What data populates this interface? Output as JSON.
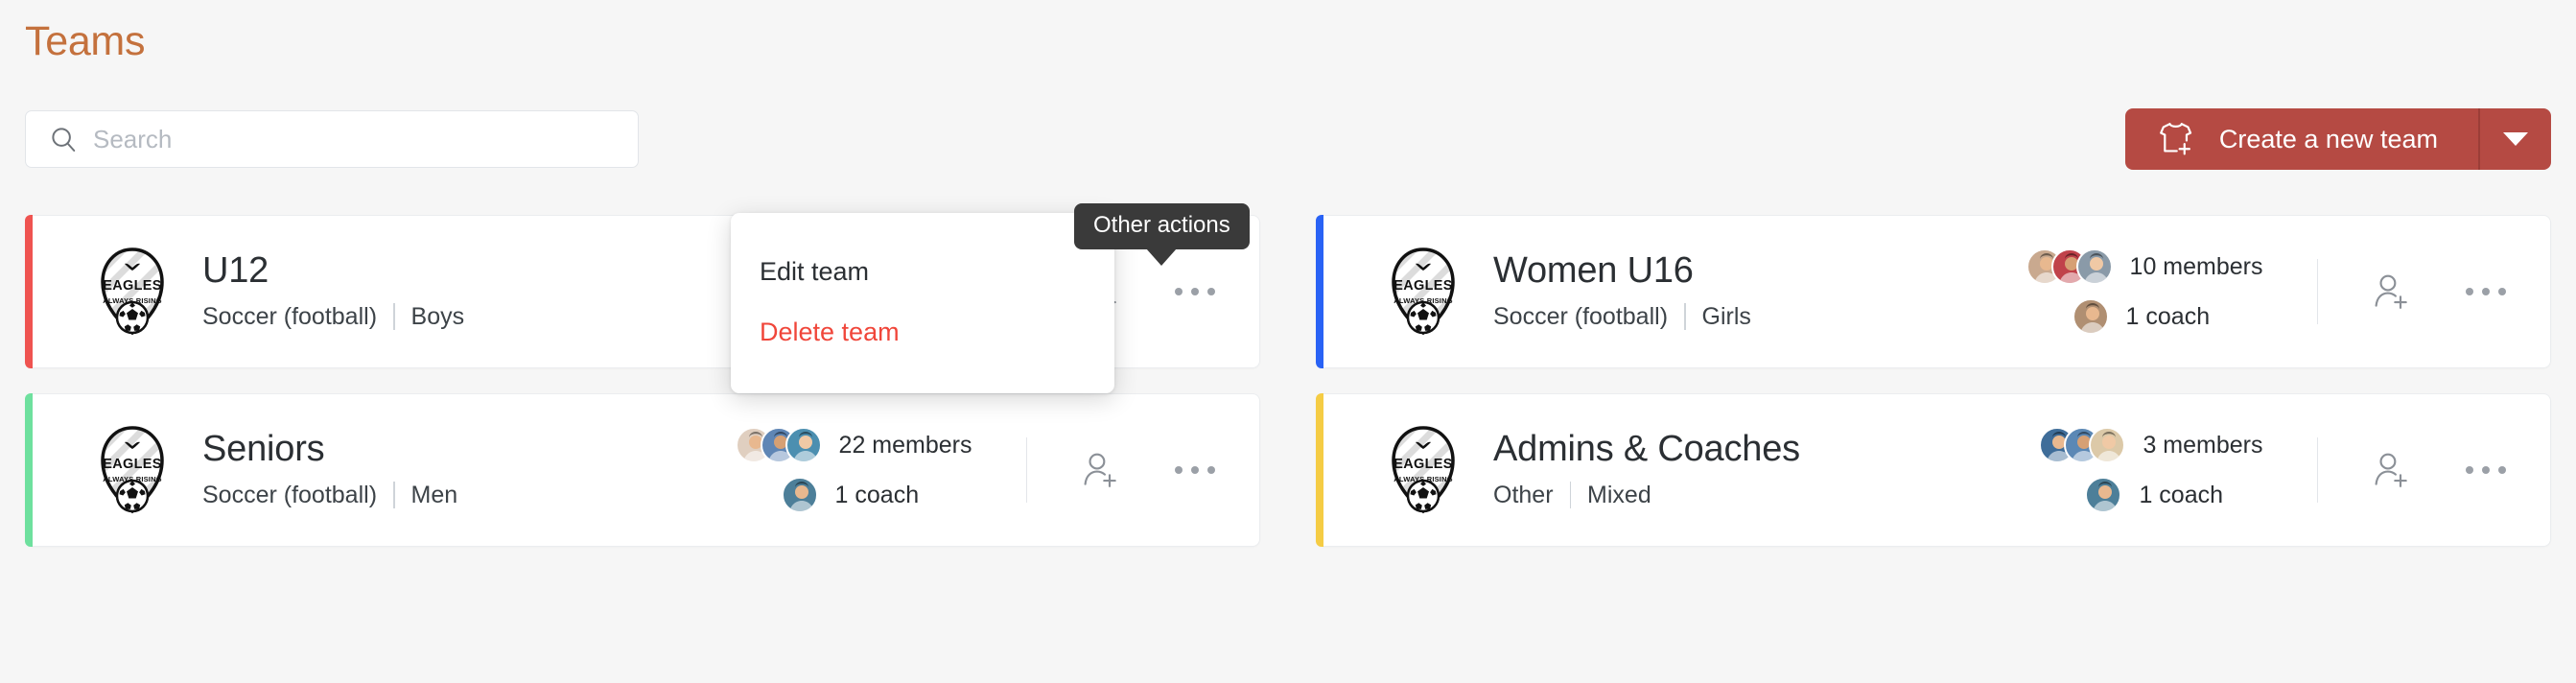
{
  "header": {
    "title": "Teams"
  },
  "search": {
    "icon": "search-icon",
    "value": "",
    "placeholder": "Search"
  },
  "create_button": {
    "icon": "jersey-plus-icon",
    "label": "Create a new team",
    "caret_icon": "chevron-down-icon",
    "color": "#b54a43"
  },
  "colors": {
    "title": "#c4713d",
    "accent_red": "#ef5350",
    "accent_blue": "#2962f5",
    "accent_green": "#6ee09e",
    "accent_yellow": "#f5cc44",
    "delete": "#f0463a",
    "tooltip_bg": "#3a3a3a"
  },
  "logo": {
    "top_text": "EAGLES",
    "bottom_text": "ALWAYS RISING"
  },
  "cards": [
    {
      "name": "U12",
      "sport": "Soccer (football)",
      "gender": "Boys",
      "members_label": "",
      "coach_label": "",
      "accent": "#ef5350",
      "member_avatars": [
        "#7d9cc0",
        "#d6c3a6",
        "#6d8f5e"
      ],
      "coach_avatars": [
        "#8fb3d9",
        "#3c4a52"
      ],
      "add_icon": "add-person-icon",
      "more_icon": "more-actions-icon"
    },
    {
      "name": "Women U16",
      "sport": "Soccer (football)",
      "gender": "Girls",
      "members_label": "10 members",
      "coach_label": "1 coach",
      "accent": "#2962f5",
      "member_avatars": [
        "#c9a98f",
        "#c0424a",
        "#8a9aa8"
      ],
      "coach_avatars": [
        "#b08f72"
      ],
      "add_icon": "add-person-icon",
      "more_icon": "more-actions-icon"
    },
    {
      "name": "Seniors",
      "sport": "Soccer (football)",
      "gender": "Men",
      "members_label": "22 members",
      "coach_label": "1 coach",
      "accent": "#6ee09e",
      "member_avatars": [
        "#e0cfc0",
        "#5f86b5",
        "#4c8fb0"
      ],
      "coach_avatars": [
        "#4d7f99"
      ],
      "add_icon": "add-person-icon",
      "more_icon": "more-actions-icon"
    },
    {
      "name": "Admins & Coaches",
      "sport": "Other",
      "gender": "Mixed",
      "members_label": "3 members",
      "coach_label": "1 coach",
      "accent": "#f5cc44",
      "member_avatars": [
        "#3f6d99",
        "#5b88b5",
        "#dcc9a8"
      ],
      "coach_avatars": [
        "#4d7f99"
      ],
      "add_icon": "add-person-icon",
      "more_icon": "more-actions-icon"
    }
  ],
  "menu": {
    "edit_label": "Edit team",
    "delete_label": "Delete team"
  },
  "tooltip": {
    "text": "Other actions"
  }
}
